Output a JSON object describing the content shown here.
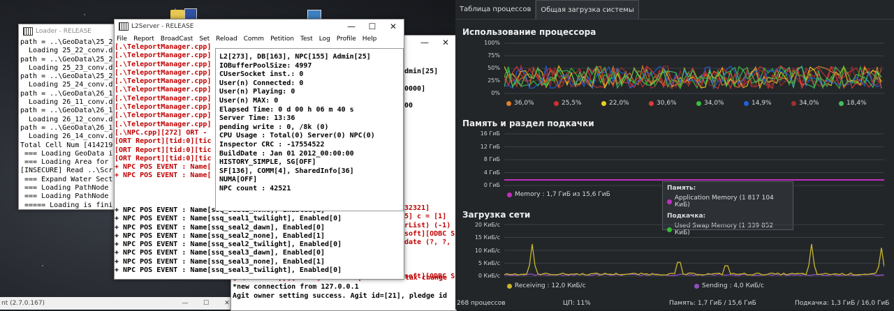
{
  "desktop": {
    "bottom_window_label": "nt (2.7.0.167)"
  },
  "loader": {
    "title": "Loader - RELEASE",
    "lines": [
      "path = ..\\GeoData\\25_2",
      "  Loading 25_22_conv.d",
      "path = ..\\GeoData\\25_2",
      "  Loading 25_23_conv.d",
      "path = ..\\GeoData\\25_2",
      "  Loading 25_24_conv.d",
      "path = ..\\GeoData\\26_1",
      "  Loading 26_11_conv.d",
      "path = ..\\GeoData\\26_1",
      "  Loading 26_12_conv.d",
      "path = ..\\GeoData\\26_1",
      "  Loading 26_14_conv.d",
      "Total Cell Num [414219",
      " === Loading GeoData i",
      " === Loading Area for",
      "[INSECURE] Read ..\\Scr",
      " === Expand Water Sect",
      " === Loading PathNode",
      " === Loading PathNode",
      " ===== Loading is fini"
    ]
  },
  "l2server": {
    "title": "L2Server - RELEASE",
    "menu": [
      "File",
      "Report",
      "BroadCast",
      "Set",
      "Reload",
      "Comm",
      "Petition",
      "Test",
      "Log",
      "Profile",
      "Help"
    ],
    "left_lines": [
      "[.\\TeleportManager.cpp]",
      "[.\\TeleportManager.cpp]",
      "[.\\TeleportManager.cpp]",
      "[.\\TeleportManager.cpp]",
      "[.\\TeleportManager.cpp]",
      "[.\\TeleportManager.cpp]",
      "[.\\TeleportManager.cpp]",
      "[.\\TeleportManager.cpp]",
      "[.\\TeleportManager.cpp]",
      "[.\\TeleportManager.cpp]",
      "[.\\NPC.cpp][272] ORT -",
      "[ORT Report][tid:0][tic",
      "[ORT Report][tid:0][tic",
      "[ORT Report][tid:0][tic",
      "+ NPC POS EVENT : Name[",
      "+ NPC POS EVENT : Name["
    ],
    "npc_lines": [
      "+ NPC POS EVENT : Name[ssq_seal1_none], Enabled[1]",
      "+ NPC POS EVENT : Name[ssq_seal1_twilight], Enabled[0]",
      "+ NPC POS EVENT : Name[ssq_seal2_dawn], Enabled[0]",
      "+ NPC POS EVENT : Name[ssq_seal2_none], Enabled[1]",
      "+ NPC POS EVENT : Name[ssq_seal2_twilight], Enabled[0]",
      "+ NPC POS EVENT : Name[ssq_seal3_dawn], Enabled[0]",
      "+ NPC POS EVENT : Name[ssq_seal3_none], Enabled[1]",
      "+ NPC POS EVENT : Name[ssq_seal3_twilight], Enabled[0]"
    ],
    "status_lines": [
      "L2[273], DB[163], NPC[155] Admin[25]",
      "IOBufferPoolSize: 4997",
      "CUserSocket inst.: 0",
      "User(n) Connected: 0",
      "User(n) Playing: 0",
      "User(n) MAX: 0",
      "Elapsed Time: 0 d 00 h 06 m 40 s",
      "Server Time: 13:36",
      "pending write : 0, /8k (0)",
      "CPU Usage : Total(0) Server(0) NPC(0)",
      "Inspector CRC : -17554522",
      "BuildDate : Jan 01 2012_00:00:00",
      "HISTORY_SIMPLE, SG[OFF]",
      "SF[136], COMM[4], SharedInfo[36]",
      "NUMA[OFF]",
      "NPC count : 42521"
    ]
  },
  "third": {
    "right_lines_top": [
      "dmin[25]",
      "",
      "0000]",
      "",
      "00"
    ],
    "red_lines": [
      "32321]",
      "5] c = [1]",
      "rList) (-1)",
      "soft][ODBC S",
      "date (?, ?,",
      "",
      "",
      "",
      "soft][ODBC S"
    ],
    "bottom_lines": [
      "[.\\Socket.cpp][10687] cannot update last tax change",
      "*new connection from 127.0.0.1",
      "Agit owner setting success. Agit id=[21], pledge id"
    ]
  },
  "system": {
    "tabs": [
      "Таблица процессов",
      "Общая загрузка системы"
    ],
    "cpu": {
      "title": "Использование процессора",
      "ticks": [
        "100%",
        "75%",
        "50%",
        "25%",
        "0%"
      ],
      "cores": [
        {
          "label": "36,0%",
          "color": "#e0802a"
        },
        {
          "label": "25,5%",
          "color": "#d03030"
        },
        {
          "label": "22,0%",
          "color": "#e8d020"
        },
        {
          "label": "30,6%",
          "color": "#e03a3a"
        },
        {
          "label": "34,0%",
          "color": "#3ac03a"
        },
        {
          "label": "14,9%",
          "color": "#2060e0"
        },
        {
          "label": "34,0%",
          "color": "#a03030"
        },
        {
          "label": "18,4%",
          "color": "#40c060"
        }
      ]
    },
    "memory": {
      "title": "Память и раздел подкачки",
      "ticks": [
        "16 ГиБ",
        "12 ГиБ",
        "8 ГиБ",
        "4 ГиБ",
        "0 ГиБ"
      ],
      "legend": "Memory : 1,7 ГиБ из 15,6 ГиБ",
      "legend_color": "#c030c0",
      "tooltip": {
        "mem_header": "Память:",
        "mem_item": "Application Memory (1 817 104 КиБ)",
        "mem_color": "#c030c0",
        "swap_header": "Подкачка:",
        "swap_item": "Used Swap Memory (1 339 852 КиБ)",
        "swap_color": "#30c030"
      }
    },
    "network": {
      "title": "Загрузка сети",
      "ticks": [
        "20 КиБ/с",
        "15 КиБ/с",
        "10 КиБ/с",
        "5 КиБ/с",
        "0 КиБ/с"
      ],
      "receiving": "Receiving : 12,0 КиБ/с",
      "receiving_color": "#c8b828",
      "sending": "Sending : 4,0 КиБ/с",
      "sending_color": "#9050c0"
    },
    "status": {
      "processes": "268 процессов",
      "cpu": "ЦП: 11%",
      "memory": "Память: 1,7 ГиБ / 15,6 ГиБ",
      "swap": "Подкачка: 1,3 ГиБ / 16,0 ГиБ"
    }
  }
}
